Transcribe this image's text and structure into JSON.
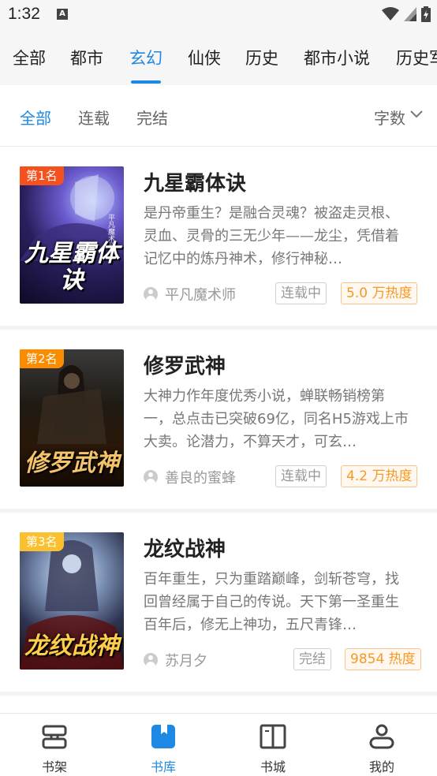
{
  "status_bar": {
    "time": "1:32",
    "notification_letter": "A"
  },
  "category_tabs": [
    {
      "label": "全部"
    },
    {
      "label": "都市"
    },
    {
      "label": "玄幻"
    },
    {
      "label": "仙侠"
    },
    {
      "label": "历史"
    },
    {
      "label": "都市小说"
    },
    {
      "label": "历史军"
    }
  ],
  "active_category": "玄幻",
  "filter": {
    "items": [
      {
        "label": "全部"
      },
      {
        "label": "连载"
      },
      {
        "label": "完结"
      }
    ],
    "active": "全部",
    "sort_label": "字数"
  },
  "books": [
    {
      "rank": "第1名",
      "rank_color": "#f4511e",
      "title": "九星霸体诀",
      "cover_title": "九星霸体诀",
      "cover_author": "平凡魔术师",
      "description": "是丹帝重生？是融合灵魂？被盗走灵根、灵血、灵骨的三无少年——龙尘，凭借着记忆中的炼丹神术，修行神秘…",
      "author": "平凡魔术师",
      "status": "连载中",
      "heat": "5.0 万热度"
    },
    {
      "rank": "第2名",
      "rank_color": "#fb8c00",
      "title": "修罗武神",
      "cover_title": "修罗武神",
      "cover_author": "善良的蜜蜂",
      "description": "大神力作年度优秀小说，蝉联畅销榜第一，总点击已突破69亿，同名H5游戏上市大卖。论潜力，不算天才，可玄…",
      "author": "善良的蜜蜂",
      "status": "连载中",
      "heat": "4.2 万热度"
    },
    {
      "rank": "第3名",
      "rank_color": "#fbc02d",
      "title": "龙纹战神",
      "cover_title": "龙纹战神",
      "cover_author": "苏月夕",
      "description": "百年重生，只为重踏巅峰，剑斩苍穹，找回曾经属于自己的传说。天下第一圣重生百年后，修无上神功，五尺青锋…",
      "author": "苏月夕",
      "status": "完结",
      "heat": "9854 热度"
    }
  ],
  "bottom_nav": [
    {
      "label": "书架",
      "icon": "bookshelf-icon"
    },
    {
      "label": "书库",
      "icon": "library-icon"
    },
    {
      "label": "书城",
      "icon": "book-open-icon"
    },
    {
      "label": "我的",
      "icon": "profile-icon"
    }
  ],
  "active_nav": "书库",
  "colors": {
    "accent": "#1e88e5",
    "heat": "#f59a23"
  }
}
